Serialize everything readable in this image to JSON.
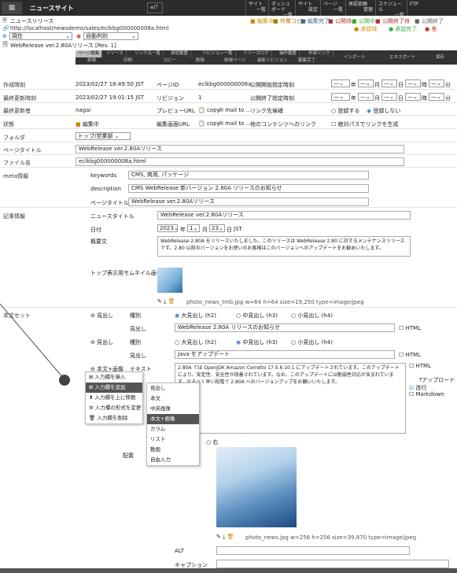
{
  "topbar": {
    "logo": "▦",
    "site": "ニュースサイト",
    "site_btn": "≡|？",
    "nav": [
      {
        "a": "サイト",
        "b": "一覧"
      },
      {
        "a": "ダッシュボード",
        "b": "一覧"
      },
      {
        "a": "サイト",
        "b": "設定"
      },
      {
        "a": "ページ",
        "b": "一覧"
      },
      {
        "a": "承認依頼",
        "b": "管理"
      },
      {
        "a": "スケジュール",
        "b": "一覧"
      },
      {
        "a": "FTP",
        "b": ""
      }
    ]
  },
  "header": {
    "title": "ニュースリリース",
    "url": "http://localhost/newsdemo/sales/eclkbg000000008a.html",
    "status_labels": [
      "編集中",
      "作業コピー",
      "編集完了",
      "公開待",
      "公開中",
      "公開終了待",
      "公開終了"
    ],
    "approval": [
      "承認待",
      "承認完了",
      "差"
    ],
    "version_select": "現在",
    "auto_select": "自動判別",
    "revision": "WebRelease ver.2.80Aリリース [Rev. 1]"
  },
  "tabs": {
    "top": [
      "ページ編集",
      "リソース",
      "リンク元一覧",
      "承認履歴",
      "リビジョン一覧",
      "リリースログ",
      "操作履歴",
      "外部リンク"
    ],
    "bottom": [
      "新規",
      "印刷",
      "コピー",
      "削除",
      "新規ページ",
      "最新リビジョン",
      "編集完了",
      "インポート",
      "エキスポート",
      "保存"
    ]
  },
  "meta": {
    "created_label": "作成時刻",
    "created": "2023/02/27 18:49:50 JST",
    "pageid_label": "ページID",
    "pageid": "eclkbg000000008a",
    "pubstart_label": "公開開始指定時刻",
    "updated_label": "最終更新時刻",
    "updated": "2023/02/27 19:01:15 JST",
    "revision_label": "リビジョン",
    "revision": "1",
    "pubend_label": "公開終了指定時刻",
    "updater_label": "最終更新者",
    "updater": "nagai",
    "preview_label": "プレビューURL",
    "copy": "copy",
    "mailto": "mail to ...",
    "linkpri_label": "リンク先候補",
    "register": "登録する",
    "noregister": "登録しない",
    "state_label": "状態",
    "state": "編集中",
    "editurl_label": "編集画面URL",
    "otherlink_label": "他のコンテンツへのリンク",
    "abspath": "絶対パスでリンクを生成",
    "folder_label": "フォルダ",
    "folder": "トップ/営業部",
    "pagetitle_label": "ページタイトル",
    "pagetitle": "WebRelease ver.2.80Aリリース",
    "filename_label": "ファイル名",
    "filename": "eclkbg000000008a.html",
    "metainfo_label": "meta情報",
    "keywords_label": "keywords",
    "keywords": "CMS, 商用, パッケージ",
    "desc_label": "description",
    "desc": "CMS WebRelease 新バージョン 2.80A リリースのお知らせ",
    "ptitle_label": "ページタイトル",
    "ptitle": "WebRelease ver.2.80Aリリース",
    "datesel": "—",
    "year_l": "年",
    "month_l": "月",
    "day_l": "日",
    "hour_l": "時",
    "min_l": "分"
  },
  "article": {
    "label": "記事情報",
    "newstitle_label": "ニュースタイトル",
    "newstitle": "WebRelease ver.2.80Aリリース",
    "date_label": "日付",
    "year": "2023",
    "month": "1",
    "day": "23",
    "jst": "JST",
    "y": "年",
    "m": "月",
    "d": "日",
    "summary_label": "概要文",
    "summary": "WebRelease 2.80A をリリースいたしました。このリリースは WebRelease 2.80 に対するメンテナンスリリースです。2.80 以前のバージョンをお使いのお客様はこのバージョンへのアップデートをお勧めいたします。",
    "thumb_label": "トップ表示用サムネイル画像",
    "thumb_file": "photo_news_tmb.jpg w=64 h=64 size=19,250 type=image/jpeg"
  },
  "body": {
    "label": "本文セット",
    "midashi": "見出し",
    "kind": "種別",
    "h2": "大見出し (h2)",
    "h3": "中見出し (h3)",
    "h4": "小見出し (h4)",
    "m1": "WebRelease 2.80A リリースのお知らせ",
    "m2": "Java をアップデート",
    "html": "HTML",
    "tb_label": "本文+画像",
    "text_label": "テキスト",
    "text": "2.80A では OpenJDK Amazon Corretto 17.0.6.10.1 にアップデートされています。このアップデートにより、安定性、安全性が改善されています。なお、このアップデートには脆弱性対応が含まれています。なるべく早い段階で 2.80A へのバージョンアップをお願いいたします。",
    "upload": "アップロード",
    "kaigyo": "改行",
    "markdown": "Markdown",
    "right": "右",
    "layout_label": "配置",
    "image_file": "photo_news.jpg w=256 h=256 size=39,870 type=image/jpeg",
    "alt_label": "ALT",
    "caption_label": "キャプション"
  },
  "ctx1": [
    "入力欄を挿入",
    "入力欄を追加",
    "入力欄を上に移動",
    "入力欄の形式を変更",
    "入力欄を削除"
  ],
  "ctx2": [
    "見出し",
    "本文",
    "中央画像",
    "本文+画像",
    "カラム",
    "リスト",
    "動画",
    "自由入力"
  ]
}
